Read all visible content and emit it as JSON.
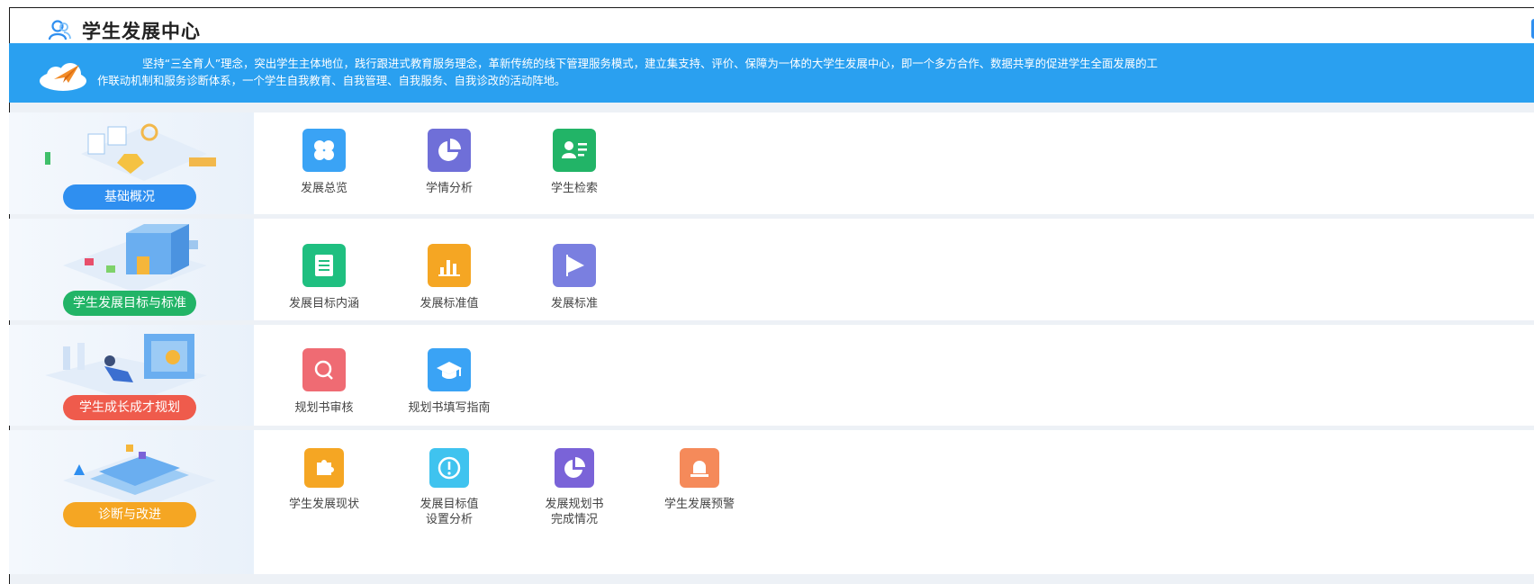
{
  "app": {
    "title": "学生发展中心",
    "power_icon": "⏻"
  },
  "banner": {
    "line1": "坚持“三全育人”理念，突出学生主体地位，践行跟进式教育服务理念，革新传统的线下管理服务模式，建立集支持、评价、保障为一体的大学生发展中心，即一个多方合作、数据共享的促进学生全面发展的工",
    "line2": "作联动机制和服务诊断体系，一个学生自我教育、自我管理、自我服务、自我诊改的活动阵地。"
  },
  "sections": [
    {
      "label": "基础概况",
      "color": "#2f8ff0",
      "items": [
        {
          "label": "发展总览",
          "icon": "grid-icon",
          "color": "#3aa3f5"
        },
        {
          "label": "学情分析",
          "icon": "pie-chart-icon",
          "color": "#6f6fd8"
        },
        {
          "label": "学生检索",
          "icon": "id-card-icon",
          "color": "#22b467"
        }
      ]
    },
    {
      "label": "学生发展目标与标准",
      "color": "#22b467",
      "items": [
        {
          "label": "发展目标内涵",
          "icon": "document-icon",
          "color": "#1fbf80"
        },
        {
          "label": "发展标准值",
          "icon": "bar-chart-icon",
          "color": "#f5a623"
        },
        {
          "label": "发展标准",
          "icon": "flag-icon",
          "color": "#7a7fe0"
        }
      ]
    },
    {
      "label": "学生成长成才规划",
      "color": "#ef5b4c",
      "items": [
        {
          "label": "规划书审核",
          "icon": "search-icon",
          "color": "#ef6b73"
        },
        {
          "label": "规划书填写指南",
          "icon": "graduation-cap-icon",
          "color": "#3aa3f5"
        }
      ]
    },
    {
      "label": "诊断与改进",
      "color": "#f5a623",
      "items": [
        {
          "label": "学生发展现状",
          "icon": "puzzle-icon",
          "color": "#f5a623"
        },
        {
          "label": "发展目标值\n设置分析",
          "icon": "alert-icon",
          "color": "#3fc3ef"
        },
        {
          "label": "发展规划书\n完成情况",
          "icon": "pie-chart-icon",
          "color": "#7a63d8"
        },
        {
          "label": "学生发展预警",
          "icon": "alarm-icon",
          "color": "#f58a5a"
        }
      ]
    }
  ]
}
